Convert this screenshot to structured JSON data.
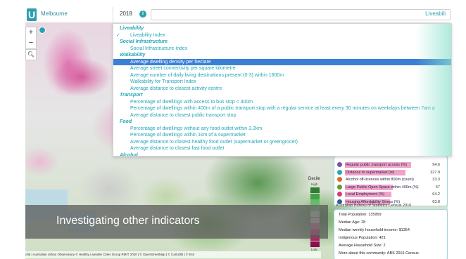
{
  "header": {
    "city": "Melbourne",
    "year": "2018",
    "selected_indicator": "Liveabili"
  },
  "dropdown": {
    "groups": [
      {
        "label": "Liveability",
        "options": [
          {
            "label": "Liveability Index",
            "checked": true
          }
        ]
      },
      {
        "label": "Social Infrastructure",
        "options": [
          {
            "label": "Social Infrastructure Index"
          }
        ]
      },
      {
        "label": "Walkability",
        "options": [
          {
            "label": "Average dwelling density per hectare",
            "highlighted": true
          },
          {
            "label": "Average street connectivity per square kilometre"
          },
          {
            "label": "Average number of daily living destinations present (0-3) within 1600m"
          },
          {
            "label": "Walkability for Transport Index"
          },
          {
            "label": "Average distance to closest activity centre"
          }
        ]
      },
      {
        "label": "Transport",
        "options": [
          {
            "label": "Percentage of dwellings with access to bus stop < 400m"
          },
          {
            "label": "Percentage of dwellings within 400m of a public transport stop with a regular service at least every 30 minutes on weekdays between 7am a"
          },
          {
            "label": "Average distance to closest public transport stop"
          }
        ]
      },
      {
        "label": "Food",
        "options": [
          {
            "label": "Percentage of dwellings without any food outlet within 3.2km"
          },
          {
            "label": "Percentage of dwellings within 1km of a supermarket"
          },
          {
            "label": "Average distance to closest healthy food outlet (supermarket or greengrocer)"
          },
          {
            "label": "Average distance to closest fast food outlet"
          }
        ]
      },
      {
        "label": "Alcohol",
        "options": []
      }
    ]
  },
  "indicators": [
    {
      "label": "Regular public transport access (%)",
      "value": "94.6",
      "color": "#7a52a8",
      "fill": 0.85
    },
    {
      "label": "Distance to supermarket (m)",
      "value": "327.9",
      "color": "#2aa7b7",
      "fill": 0.78
    },
    {
      "label": "Alcohol off-licences within 800m (count)",
      "value": "33.3",
      "color": "#e06a2c",
      "fill": 0.0
    },
    {
      "label": "Large Public Open Space within 400m (%)",
      "value": "67",
      "color": "#5e9a3a",
      "fill": 0.62
    },
    {
      "label": "Local Employment (%)",
      "value": "64.2",
      "color": "#d23a7b",
      "fill": 0.6
    },
    {
      "label": "Housing Affordability Stress (%)",
      "value": "63.8",
      "color": "#2f5b9c",
      "fill": 0.58
    }
  ],
  "census": {
    "title": "Australian Bureau of Statistics Census 2016",
    "rows": [
      "Total Population: 135959",
      "Median Age: 28",
      "Median weekly household income: $1354",
      "Indigenous Population: 421",
      "Average Household Size: 2",
      "More about this community: ABS 2016 Census"
    ]
  },
  "legend": {
    "title": "Decile",
    "high": "High",
    "low": "Low",
    "colors": [
      "#2e7d32",
      "#43a047",
      "#66bb6a",
      "#a5d6a7",
      "#e8f5e9",
      "#f8e1ec",
      "#f48fb1",
      "#e0588f",
      "#c2185b",
      "#880e4f"
    ]
  },
  "caption": "Investigating other indicators",
  "attribution": "ofid | Australian Urban Observatory © Healthy Liveable Cities Group RMIT 2020 | © OpenStreetMap | © CartoDB | © Esri"
}
